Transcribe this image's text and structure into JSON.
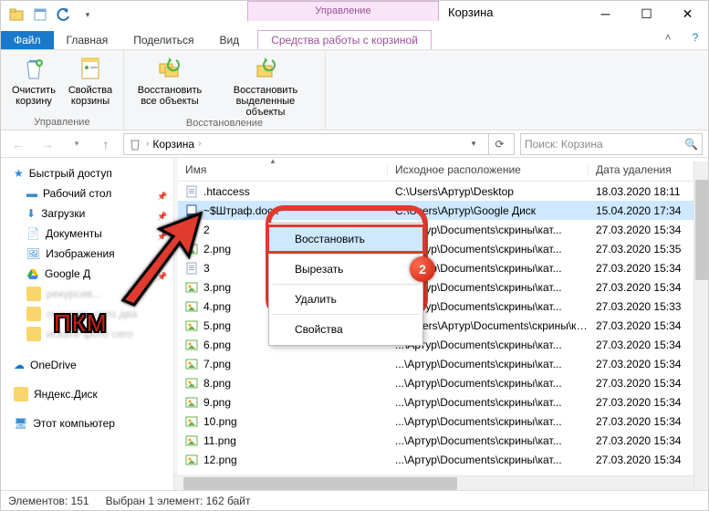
{
  "window": {
    "title": "Корзина",
    "management_tab": "Управление"
  },
  "tabs": {
    "file": "Файл",
    "home": "Главная",
    "share": "Поделиться",
    "view": "Вид",
    "tools": "Средства работы с корзиной"
  },
  "ribbon": {
    "group1": {
      "title": "Управление",
      "empty": "Очистить корзину",
      "props": "Свойства корзины"
    },
    "group2": {
      "title": "Восстановление",
      "restore_all": "Восстановить все объекты",
      "restore_sel": "Восстановить выделенные объекты"
    }
  },
  "address": {
    "location": "Корзина",
    "sep": "›"
  },
  "search": {
    "placeholder": "Поиск: Корзина"
  },
  "columns": {
    "name": "Имя",
    "location": "Исходное расположение",
    "date": "Дата удаления"
  },
  "sidebar": {
    "quick": "Быстрый доступ",
    "desktop": "Рабочий стол",
    "downloads": "Загрузки",
    "documents": "Документы",
    "pictures": "Изображения",
    "gdrive": "Google Д",
    "b1": "рекурсив...",
    "b2": "очистить сего два",
    "b3": "искать фото сего",
    "onedrive": "OneDrive",
    "yadisk": "Яндекс.Диск",
    "thispc": "Этот компьютер"
  },
  "files": [
    {
      "name": ".htaccess",
      "loc": "C:\\Users\\Артур\\Desktop",
      "date": "18.03.2020 18:11",
      "ico": "txt"
    },
    {
      "name": "~$Штраф.docx",
      "loc": "C:\\Users\\Артур\\Google Диск",
      "date": "15.04.2020 17:34",
      "ico": "doc",
      "selected": true
    },
    {
      "name": "2",
      "loc": "...\\Артур\\Documents\\скрины\\кат...",
      "date": "27.03.2020 15:34",
      "ico": "txt"
    },
    {
      "name": "2.png",
      "loc": "...\\Артур\\Documents\\скрины\\кат...",
      "date": "27.03.2020 15:35",
      "ico": "img"
    },
    {
      "name": "3",
      "loc": "...\\Артур\\Documents\\скрины\\кат...",
      "date": "27.03.2020 15:34",
      "ico": "txt"
    },
    {
      "name": "3.png",
      "loc": "...\\Артур\\Documents\\скрины\\кат...",
      "date": "27.03.2020 15:34",
      "ico": "img"
    },
    {
      "name": "4.png",
      "loc": "...\\Артур\\Documents\\скрины\\кат...",
      "date": "27.03.2020 15:33",
      "ico": "img"
    },
    {
      "name": "5.png",
      "loc": "C:\\Users\\Артур\\Documents\\скрины\\кат...",
      "date": "27.03.2020 15:34",
      "ico": "img"
    },
    {
      "name": "6.png",
      "loc": "...\\Артур\\Documents\\скрины\\кат...",
      "date": "27.03.2020 15:34",
      "ico": "img"
    },
    {
      "name": "7.png",
      "loc": "...\\Артур\\Documents\\скрины\\кат...",
      "date": "27.03.2020 15:34",
      "ico": "img"
    },
    {
      "name": "8.png",
      "loc": "...\\Артур\\Documents\\скрины\\кат...",
      "date": "27.03.2020 15:34",
      "ico": "img"
    },
    {
      "name": "9.png",
      "loc": "...\\Артур\\Documents\\скрины\\кат...",
      "date": "27.03.2020 15:34",
      "ico": "img"
    },
    {
      "name": "10.png",
      "loc": "...\\Артур\\Documents\\скрины\\кат...",
      "date": "27.03.2020 15:34",
      "ico": "img"
    },
    {
      "name": "11.png",
      "loc": "...\\Артур\\Documents\\скрины\\кат...",
      "date": "27.03.2020 15:34",
      "ico": "img"
    },
    {
      "name": "12.png",
      "loc": "...\\Артур\\Documents\\скрины\\кат...",
      "date": "27.03.2020 15:34",
      "ico": "img"
    }
  ],
  "context": {
    "restore": "Восстановить",
    "cut": "Вырезать",
    "delete": "Удалить",
    "props": "Свойства",
    "badge": "2"
  },
  "status": {
    "count": "Элементов: 151",
    "selection": "Выбран 1 элемент: 162 байт"
  },
  "annot": {
    "pkm": "ПКМ"
  }
}
